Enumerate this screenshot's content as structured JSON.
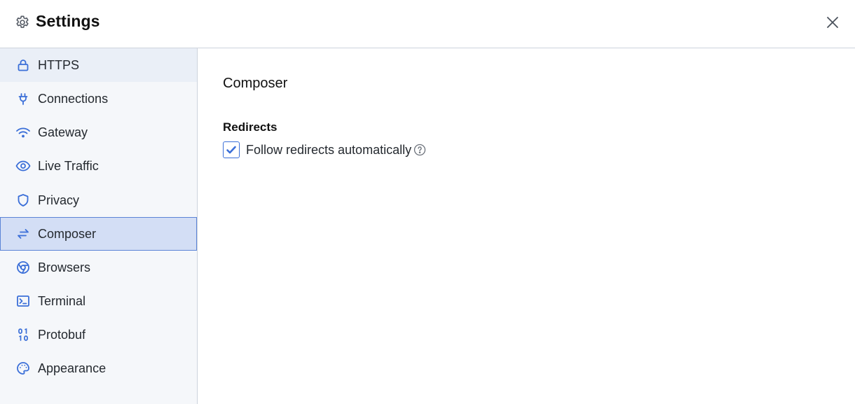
{
  "header": {
    "title": "Settings",
    "icon": "gear-icon",
    "close_icon": "close-icon"
  },
  "colors": {
    "accent": "#3b6fd8",
    "sidebar_bg": "#f5f7fa",
    "active_bg": "#d3def5",
    "active_border": "#5b84d6",
    "hover_bg": "#eaeff7",
    "border": "#cdd3dc"
  },
  "sidebar": {
    "items": [
      {
        "label": "HTTPS",
        "icon": "lock-icon",
        "state": "hover"
      },
      {
        "label": "Connections",
        "icon": "plug-icon"
      },
      {
        "label": "Gateway",
        "icon": "wifi-icon"
      },
      {
        "label": "Live Traffic",
        "icon": "eye-icon"
      },
      {
        "label": "Privacy",
        "icon": "shield-icon"
      },
      {
        "label": "Composer",
        "icon": "arrows-exchange-icon",
        "state": "active"
      },
      {
        "label": "Browsers",
        "icon": "chrome-icon"
      },
      {
        "label": "Terminal",
        "icon": "terminal-icon"
      },
      {
        "label": "Protobuf",
        "icon": "binary-icon"
      },
      {
        "label": "Appearance",
        "icon": "palette-icon"
      }
    ]
  },
  "main": {
    "section_title": "Composer",
    "groups": [
      {
        "title": "Redirects",
        "options": [
          {
            "label": "Follow redirects automatically",
            "checked": true,
            "help_icon": "help-circle-icon"
          }
        ]
      }
    ]
  }
}
